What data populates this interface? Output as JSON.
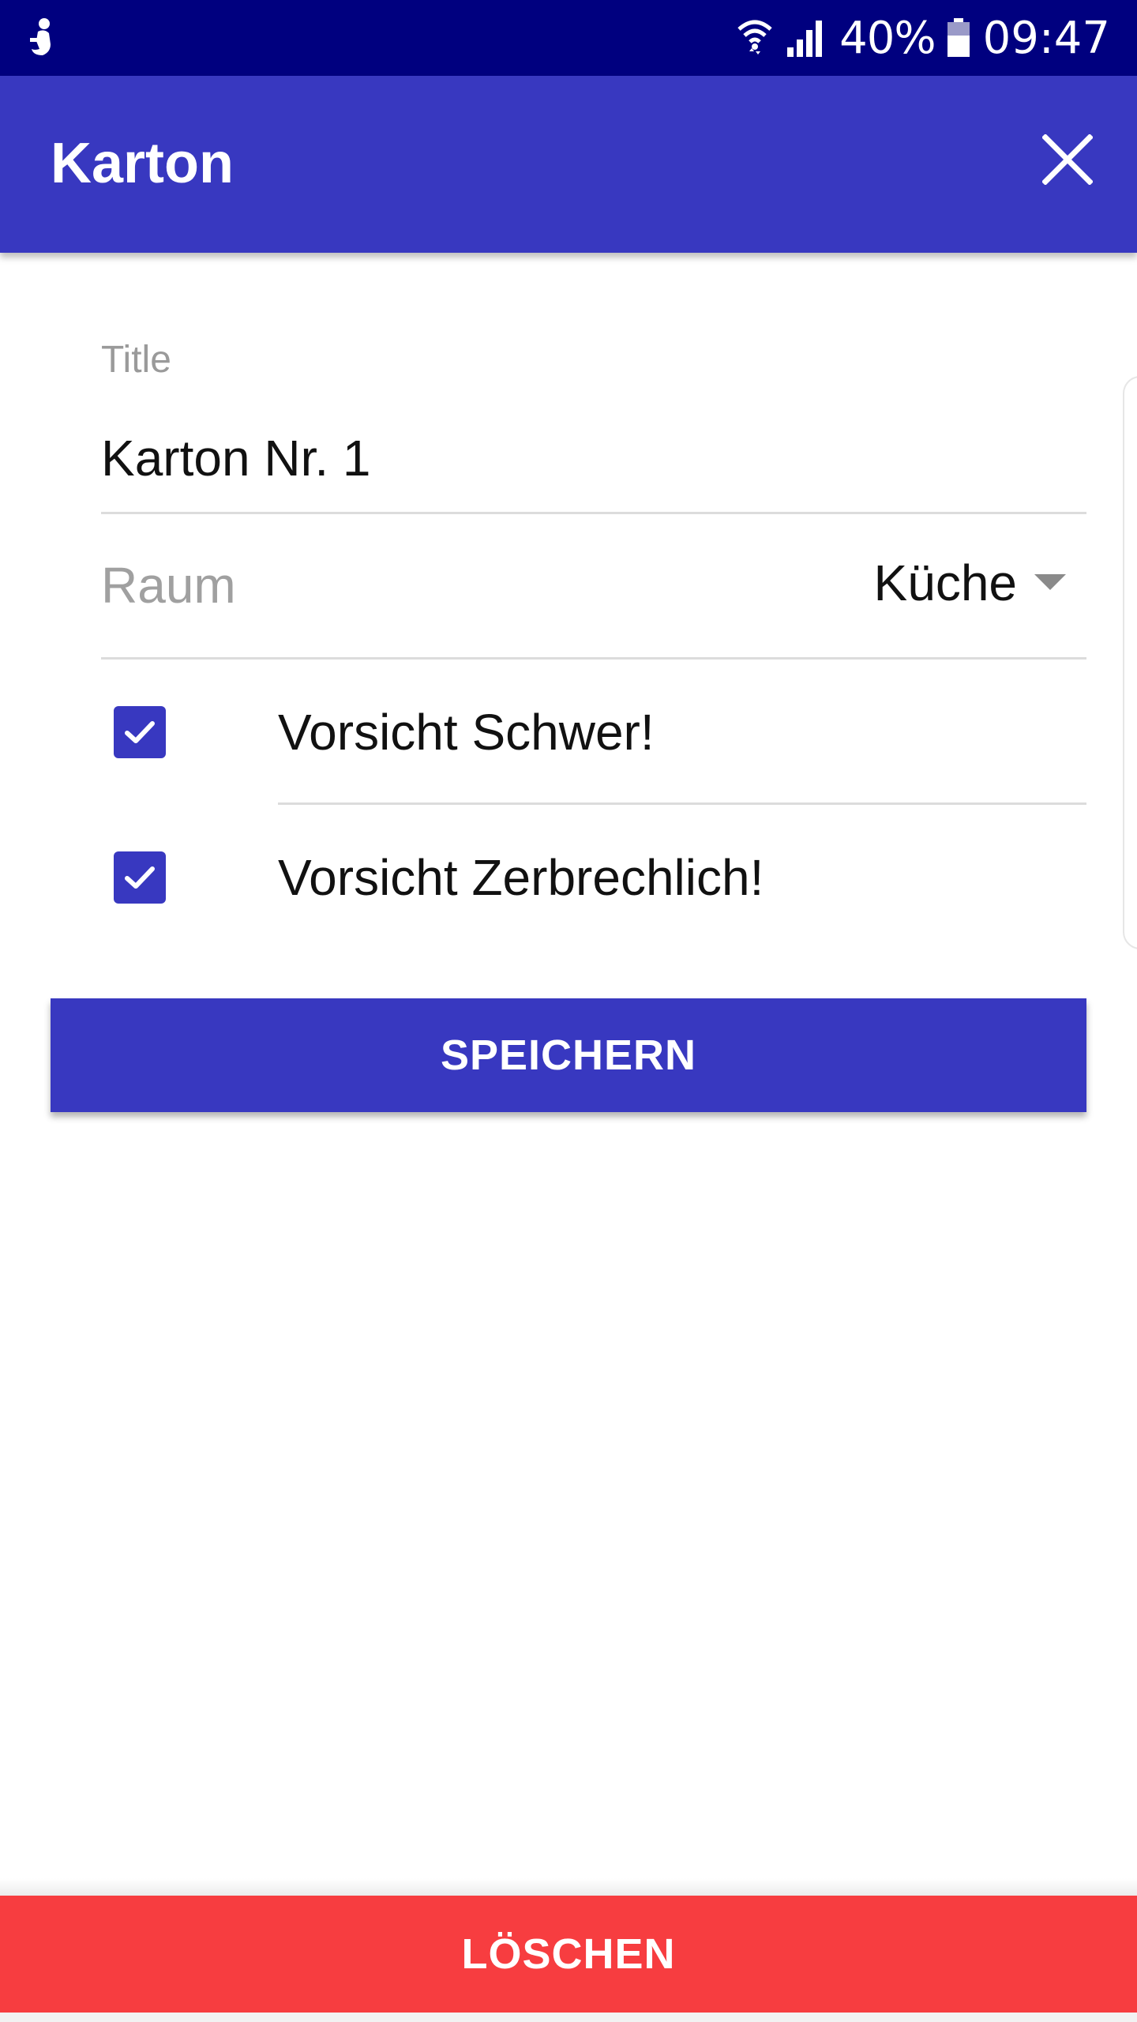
{
  "status_bar": {
    "battery_percent": "40%",
    "time": "09:47",
    "icons": [
      "notification-figure-icon",
      "wifi-icon",
      "signal-icon",
      "battery-icon"
    ]
  },
  "app_bar": {
    "title": "Karton",
    "close_icon": "close-icon"
  },
  "form": {
    "title_label": "Title",
    "title_value": "Karton Nr. 1",
    "raum_label": "Raum",
    "raum_value": "Küche",
    "checkboxes": [
      {
        "label": "Vorsicht Schwer!",
        "checked": true
      },
      {
        "label": "Vorsicht Zerbrechlich!",
        "checked": true
      }
    ]
  },
  "buttons": {
    "save_label": "SPEICHERN",
    "delete_label": "LÖSCHEN"
  },
  "colors": {
    "status_bar": "#00007f",
    "primary": "#3838c0",
    "danger": "#f73d40"
  }
}
